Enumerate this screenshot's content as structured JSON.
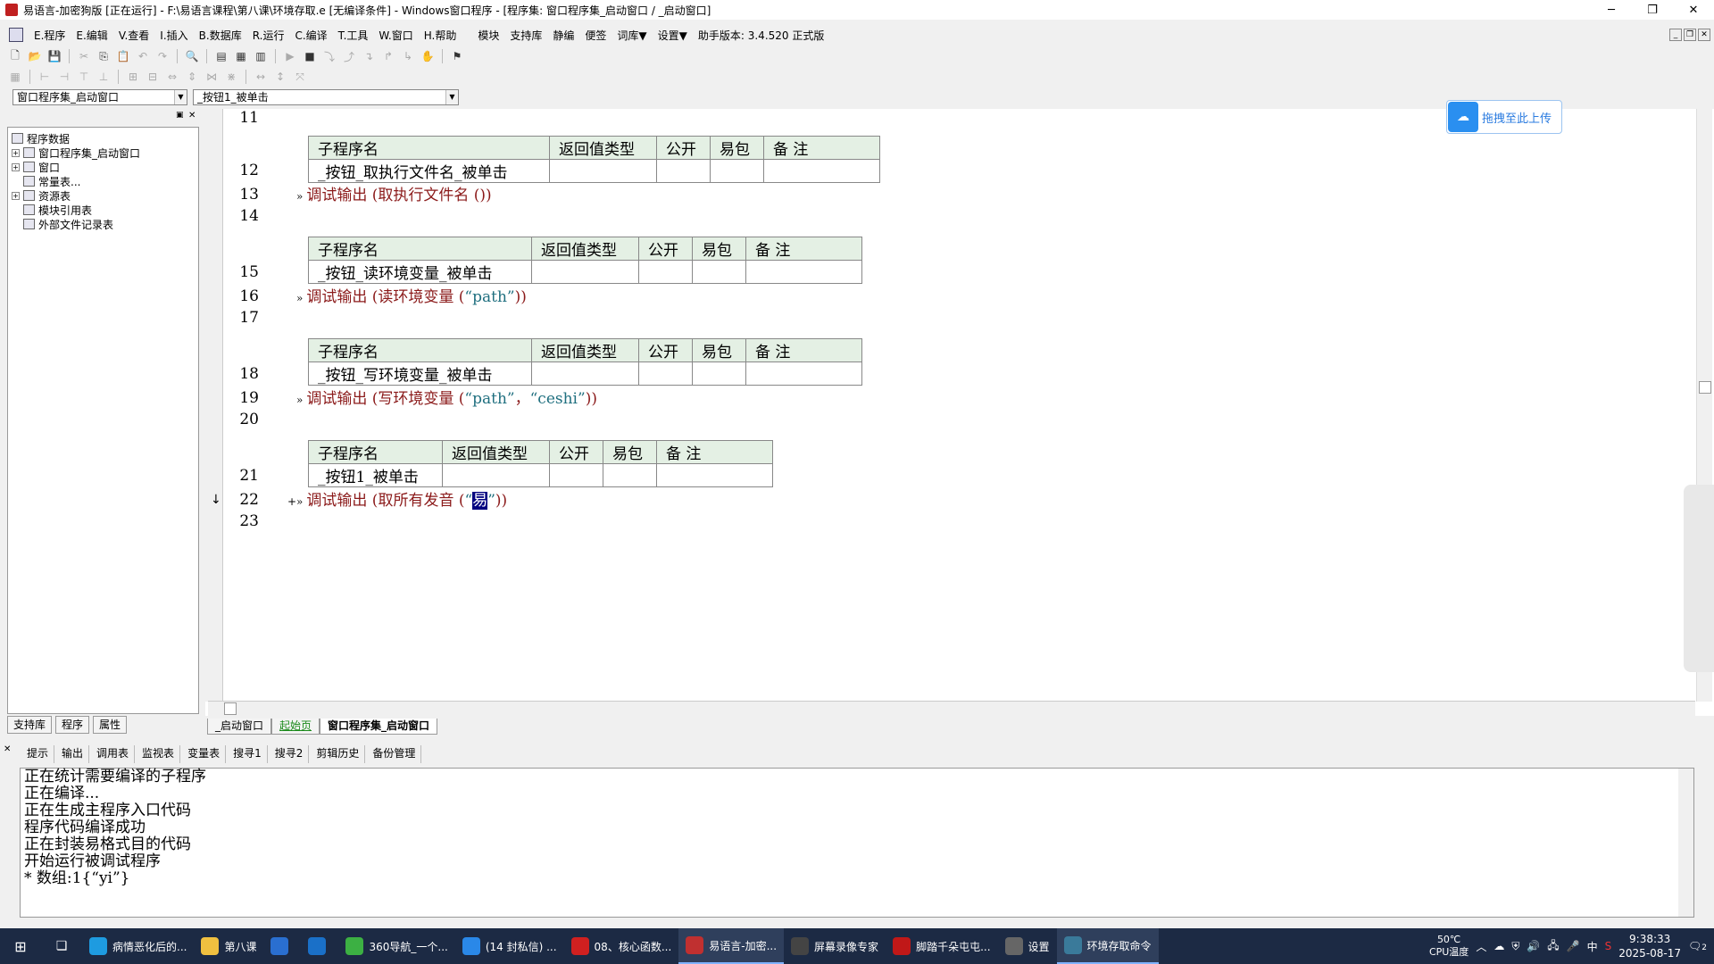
{
  "window": {
    "title": "易语言-加密狗版 [正在运行] - F:\\易语言课程\\第八课\\环境存取.e [无编译条件] - Windows窗口程序 - [程序集: 窗口程序集_启动窗口 / _启动窗口]",
    "min": "─",
    "max": "❐",
    "close": "✕"
  },
  "menu": {
    "items": [
      "E.程序",
      "E.编辑",
      "V.查看",
      "I.插入",
      "B.数据库",
      "R.运行",
      "C.编译",
      "T.工具",
      "W.窗口",
      "H.帮助",
      "模块",
      "支持库",
      "静编",
      "便签",
      "词库▼",
      "设置▼",
      "助手版本: 3.4.520 正式版"
    ],
    "mdi": [
      "_",
      "❐",
      "✕"
    ]
  },
  "combos": {
    "left": "窗口程序集_启动窗口",
    "right": "_按钮1_被单击"
  },
  "tree": {
    "items": [
      {
        "label": "程序数据",
        "exp": ""
      },
      {
        "label": "窗口程序集_启动窗口",
        "exp": "+"
      },
      {
        "label": "窗口",
        "exp": "+"
      },
      {
        "label": "常量表...",
        "exp": ""
      },
      {
        "label": "资源表",
        "exp": "+"
      },
      {
        "label": "模块引用表",
        "exp": ""
      },
      {
        "label": "外部文件记录表",
        "exp": ""
      }
    ]
  },
  "left_tabs": [
    "支持库",
    "程序",
    "属性"
  ],
  "editor": {
    "line_numbers": [
      "11",
      "12",
      "13",
      "14",
      "15",
      "16",
      "17",
      "18",
      "19",
      "20",
      "21",
      "22",
      "23"
    ],
    "table_headers": [
      "子程序名",
      "返回值类型",
      "公开",
      "易包",
      "备 注"
    ],
    "subs": [
      "_按钮_取执行文件名_被单击",
      "_按钮_读环境变量_被单击",
      "_按钮_写环境变量_被单击",
      "_按钮1_被单击"
    ],
    "line13": {
      "cmd": "调试输出 (取执行文件名 ())"
    },
    "line16": {
      "cmd": "调试输出 (读环境变量 (",
      "str": "“path”",
      "end": "))"
    },
    "line19": {
      "cmd": "调试输出 (写环境变量 (",
      "str1": "“path”",
      "comma": "，",
      "str2": "“ceshi”",
      "end": "))"
    },
    "line22": {
      "cmd": "调试输出 (取所有发音 (",
      "q1": "“",
      "sel": "易",
      "q2": "”",
      "end": "))"
    },
    "current_marker": "↓"
  },
  "upload": {
    "label": "拖拽至此上传"
  },
  "edit_tabs": [
    "_启动窗口",
    "起始页",
    "窗口程序集_启动窗口"
  ],
  "bottom_tabs": [
    "提示",
    "输出",
    "调用表",
    "监视表",
    "变量表",
    "搜寻1",
    "搜寻2",
    "剪辑历史",
    "备份管理"
  ],
  "output": {
    "lines": [
      "正在统计需要编译的子程序",
      "正在编译...",
      "正在生成主程序入口代码",
      "程序代码编译成功",
      "正在封装易格式目的代码",
      "开始运行被调试程序",
      "* 数组:1{“yi”}"
    ]
  },
  "taskbar": {
    "items": [
      {
        "label": "病情恶化后的...",
        "color": "#1e9be0"
      },
      {
        "label": "第八课",
        "color": "#f0c040"
      },
      {
        "label": "",
        "color": "#2a6fd0"
      },
      {
        "label": "",
        "color": "#1a70c8"
      },
      {
        "label": "360导航_一个...",
        "color": "#3cb043"
      },
      {
        "label": "(14 封私信) ...",
        "color": "#2a88e8"
      },
      {
        "label": "08、核心函数...",
        "color": "#d02020"
      },
      {
        "label": "易语言-加密...",
        "color": "#c03030"
      },
      {
        "label": "屏幕录像专家",
        "color": "#444"
      },
      {
        "label": "脚踏千朵屯屯...",
        "color": "#c01818"
      },
      {
        "label": "设置",
        "color": "#666"
      },
      {
        "label": "环境存取命令",
        "color": "#3a7a9a"
      }
    ],
    "temp": "50℃",
    "temp_label": "CPU温度",
    "time": "9:38:33",
    "date": "2025-08-17",
    "ime": "中",
    "notif": "2"
  }
}
